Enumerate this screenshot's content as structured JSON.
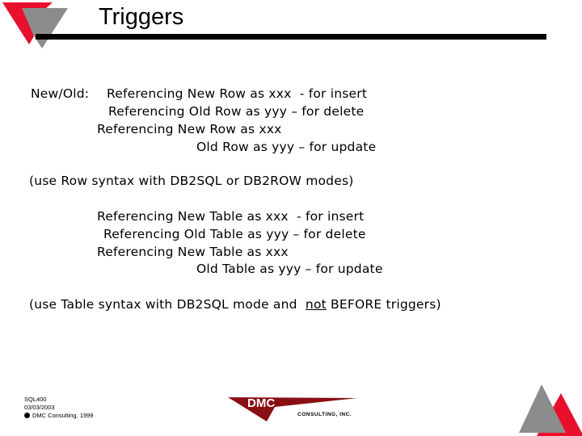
{
  "slide": {
    "title": "Triggers",
    "colors": {
      "accent_red": "#e8102c",
      "accent_gray": "#8c8c8c",
      "brand_maroon": "#8a0f14"
    }
  },
  "row_section": {
    "label": "New/Old:",
    "lines": [
      "Referencing New Row as xxx  - for insert",
      "Referencing Old Row as yyy – for delete",
      "Referencing New Row as xxx",
      "Old Row as yyy – for update"
    ],
    "note": "(use Row syntax with DB2SQL or DB2ROW modes)"
  },
  "table_section": {
    "lines": [
      "Referencing New Table as xxx  - for insert",
      "Referencing Old Table as yyy – for delete",
      "Referencing New Table as xxx",
      "Old Table as yyy – for update"
    ],
    "note_before": "(use Table syntax with DB2SQL mode and  ",
    "note_emph": "not",
    "note_after": " BEFORE triggers)"
  },
  "footer": {
    "course": "SQL400",
    "date": "03/03/2003",
    "copyright": "DMC Consulting, 1999"
  },
  "brand_logo": {
    "name": "DMC",
    "subtitle": "CONSULTING, INC."
  }
}
